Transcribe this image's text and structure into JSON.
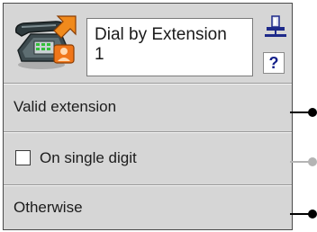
{
  "node": {
    "title": "Dial by Extension\n1",
    "icon": "telephone-handset-icon",
    "pin_icon": "pin-icon",
    "help_label": "?"
  },
  "branches": [
    {
      "label": "Valid extension",
      "has_checkbox": false,
      "checked": false,
      "connector_color": "#000000"
    },
    {
      "label": "On single digit",
      "has_checkbox": true,
      "checked": false,
      "connector_color": "#b4b4b4"
    },
    {
      "label": "Otherwise",
      "has_checkbox": false,
      "checked": false,
      "connector_color": "#000000"
    }
  ],
  "colors": {
    "panel_background": "#d6d6d6",
    "help_glyph": "#14208a",
    "active_connector": "#000000",
    "inactive_connector": "#b4b4b4"
  }
}
